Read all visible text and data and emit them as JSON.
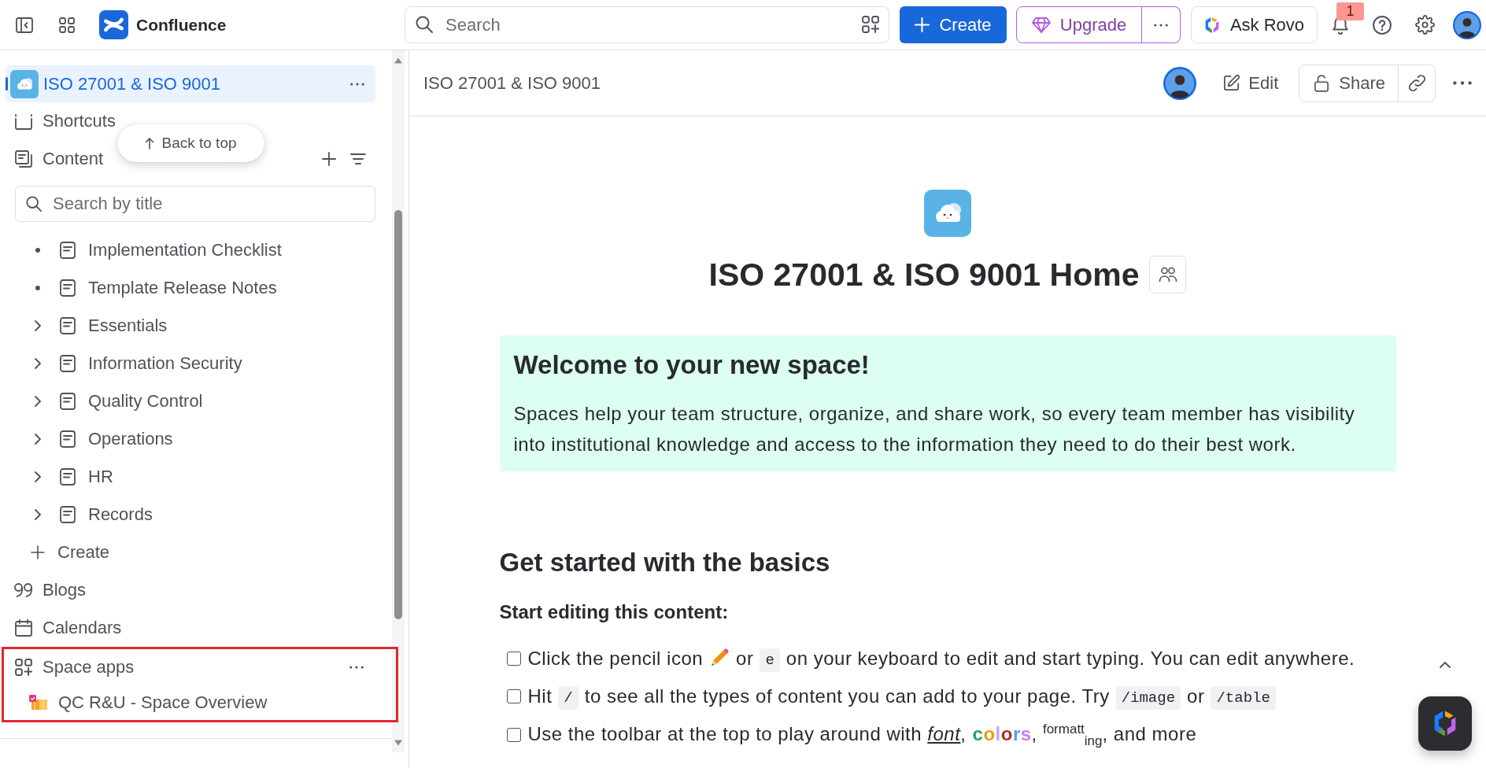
{
  "top_bar": {
    "product_name": "Confluence",
    "search": {
      "placeholder": "Search"
    },
    "create_button": "Create",
    "upgrade_button": "Upgrade",
    "ask_button": "Ask Rovo",
    "notifications": {
      "count": "1"
    }
  },
  "sidebar": {
    "space": {
      "name": "ISO 27001 & ISO 9001",
      "selected": true
    },
    "shortcuts": "Shortcuts",
    "back_to_top": "Back to top",
    "content": {
      "label": "Content",
      "search": {
        "placeholder": "Search by title"
      },
      "pages": [
        {
          "title": "Implementation Checklist",
          "kind": "leaf"
        },
        {
          "title": "Template Release Notes",
          "kind": "leaf"
        },
        {
          "title": "Essentials",
          "kind": "parent",
          "expanded": false
        },
        {
          "title": "Information Security",
          "kind": "parent",
          "expanded": false
        },
        {
          "title": "Quality Control",
          "kind": "parent",
          "expanded": false
        },
        {
          "title": "Operations",
          "kind": "parent",
          "expanded": false
        },
        {
          "title": "HR",
          "kind": "parent",
          "expanded": false
        },
        {
          "title": "Records",
          "kind": "parent",
          "expanded": false
        }
      ],
      "create": "Create"
    },
    "blogs": "Blogs",
    "calendars": "Calendars",
    "space_apps": {
      "label": "Space apps",
      "highlighted": true,
      "apps": [
        {
          "name": "QC R&U - Space Overview"
        }
      ]
    }
  },
  "page": {
    "breadcrumb": "ISO 27001 & ISO 9001",
    "edit_button": "Edit",
    "share_button": "Share",
    "title": "ISO 27001 & ISO 9001 Home",
    "welcome": {
      "heading": "Welcome to your new space!",
      "text": "Spaces help your team structure, organize, and share work, so every team member has visibility into institutional knowledge and access to the information they need to do their best work."
    },
    "section_heading": "Get started with the basics",
    "subheading": "Start editing this content:",
    "checklist": [
      {
        "checked": false,
        "parts": [
          {
            "kind": "text",
            "text": "Click the pencil icon"
          },
          {
            "kind": "icon"
          },
          {
            "kind": "text",
            "text": "or"
          },
          {
            "kind": "code",
            "text": "e"
          },
          {
            "kind": "text",
            "text": "on your keyboard to edit and start typing. You can edit anywhere."
          }
        ]
      },
      {
        "checked": false,
        "parts": [
          {
            "kind": "text",
            "text": "Hit"
          },
          {
            "kind": "code",
            "text": "/"
          },
          {
            "kind": "text",
            "text": "to see all the types of content you can add to your page. Try"
          },
          {
            "kind": "code",
            "text": "/image"
          },
          {
            "kind": "text",
            "text": "or"
          },
          {
            "kind": "code",
            "text": "/table"
          }
        ]
      },
      {
        "checked": false,
        "parts": [
          {
            "kind": "text",
            "text": "Use the toolbar at the top to play around with *font*,"
          },
          {
            "kind": "colored",
            "letters": [
              {
                "text": "c",
                "color": "#22a06b"
              },
              {
                "text": "o",
                "color": "#e2a203"
              },
              {
                "text": "l",
                "color": "#b8acf6"
              },
              {
                "text": "o",
                "color": "#ae2e24"
              },
              {
                "text": "r",
                "color": "#579dff"
              },
              {
                "text": "s",
                "color": "#c97cf4"
              }
            ]
          },
          {
            "kind": "text",
            "text": ", $^{formatt}$$_{ing}$, and more"
          }
        ]
      }
    ]
  }
}
